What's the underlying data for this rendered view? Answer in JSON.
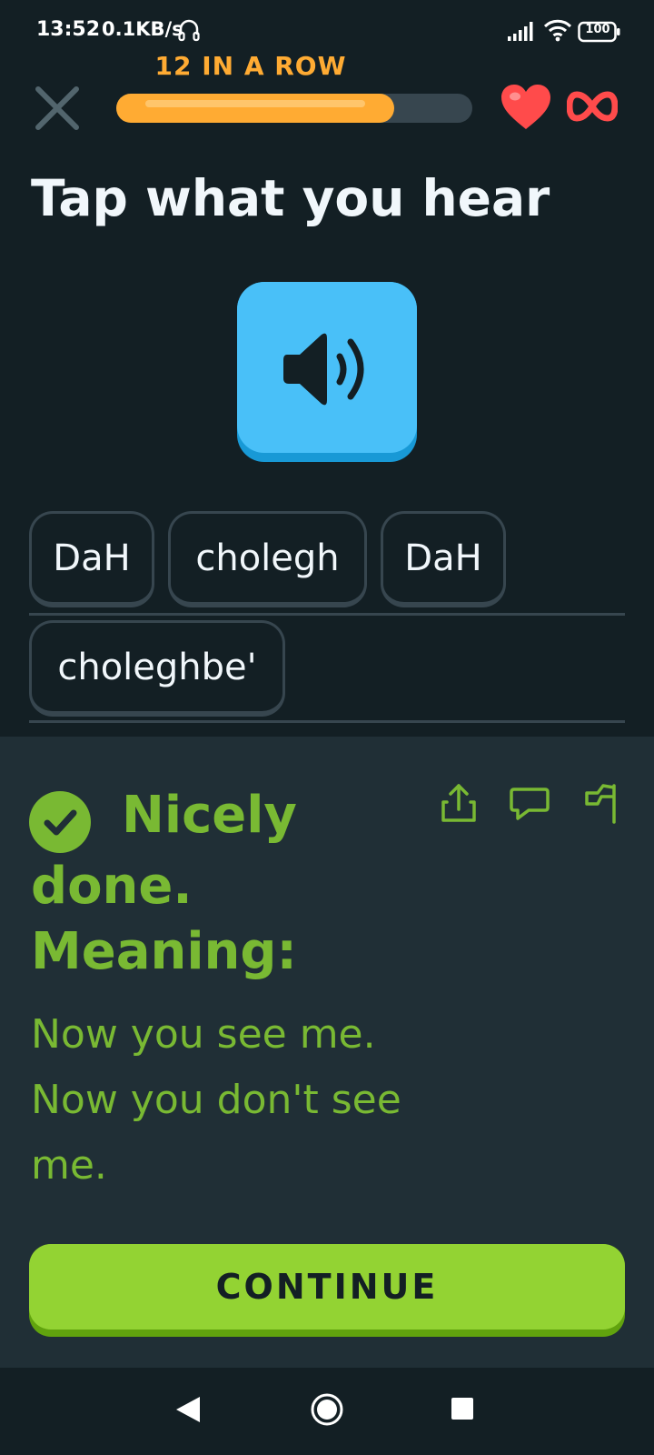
{
  "status_bar": {
    "time": "13:52",
    "speed": "0.1KB/s",
    "battery": "100",
    "icons": [
      "headphone-icon",
      "signal-icon",
      "wifi-icon",
      "battery-icon"
    ]
  },
  "header": {
    "streak_label": "12 IN A ROW",
    "progress": 0.78,
    "close_icon": "close-icon",
    "hearts_icon": "heart-icon",
    "hearts_value_icon": "infinity-icon"
  },
  "exercise": {
    "title": "Tap what you hear",
    "speaker_icon": "speaker-icon",
    "word_bank": [
      "DaH",
      "cholegh",
      "DaH",
      "choleghbe'"
    ]
  },
  "feedback": {
    "headline": "Nicely done.",
    "meaning_label": "Meaning:",
    "meaning_text": "Now you see me. Now you don't see me.",
    "actions": [
      "share-icon",
      "discuss-icon",
      "report-flag-icon"
    ],
    "continue_label": "CONTINUE"
  },
  "colors": {
    "background": "#131f24",
    "panel": "#202f36",
    "green": "#79b933",
    "button_green": "#93d333",
    "orange": "#ffab33",
    "blue": "#49c0f8",
    "heart_red": "#ff4b4b"
  }
}
